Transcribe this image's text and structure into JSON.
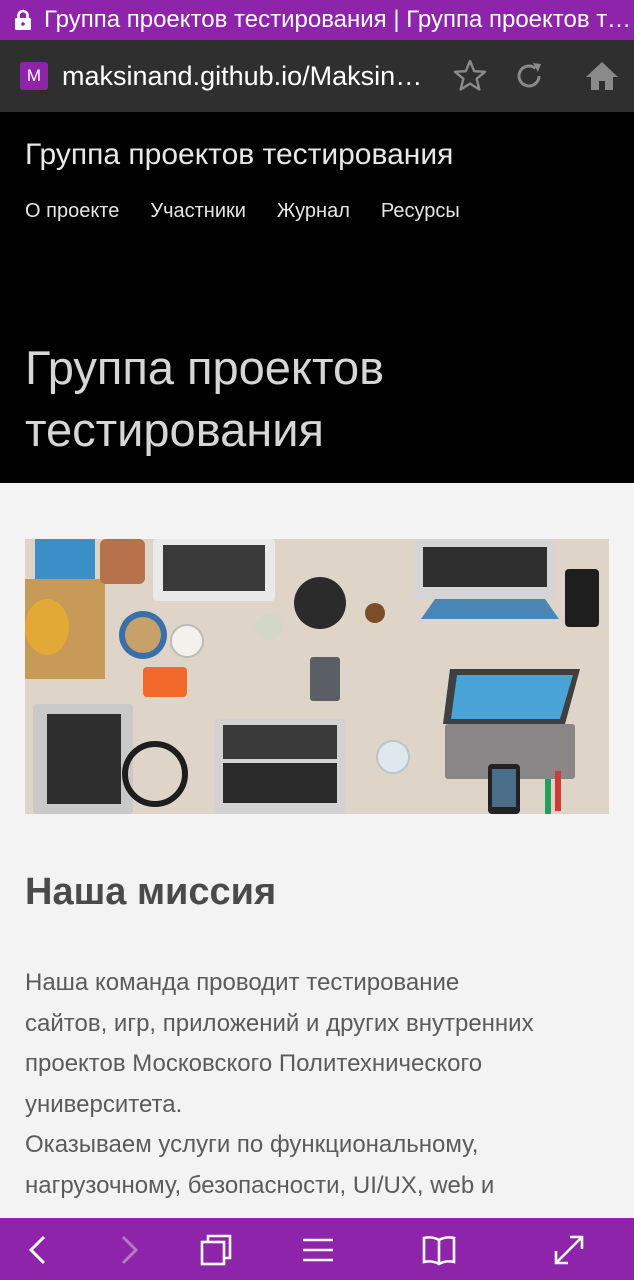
{
  "browser": {
    "tab_title": "Группа проектов тестирования | Группа проектов тестирования",
    "favicon_letter": "M",
    "url": "maksinand.github.io/MaksinAndrey",
    "accent_color": "#8e24aa",
    "address_bar_icons": [
      "star-icon",
      "reload-icon",
      "home-icon"
    ],
    "bottom_bar_icons": [
      "back-icon",
      "forward-icon",
      "tabs-icon",
      "menu-icon",
      "bookmarks-icon",
      "fullscreen-icon"
    ]
  },
  "site": {
    "name": "Группа проектов тестирования",
    "nav": [
      "О проекте",
      "Участники",
      "Журнал",
      "Ресурсы"
    ],
    "hero_title": "Группа проектов тестирования"
  },
  "content": {
    "image_alt": "team-workspace-photo",
    "heading": "Наша миссия",
    "paragraph_lines": [
      "Наша команда проводит тестирование",
      "сайтов, игр, приложений и других внутренних",
      "проектов Московского Политехнического",
      "университета.",
      "Оказываем услуги по функциональному,",
      "нагрузочному, безопасности, UI/UX, web и"
    ]
  }
}
